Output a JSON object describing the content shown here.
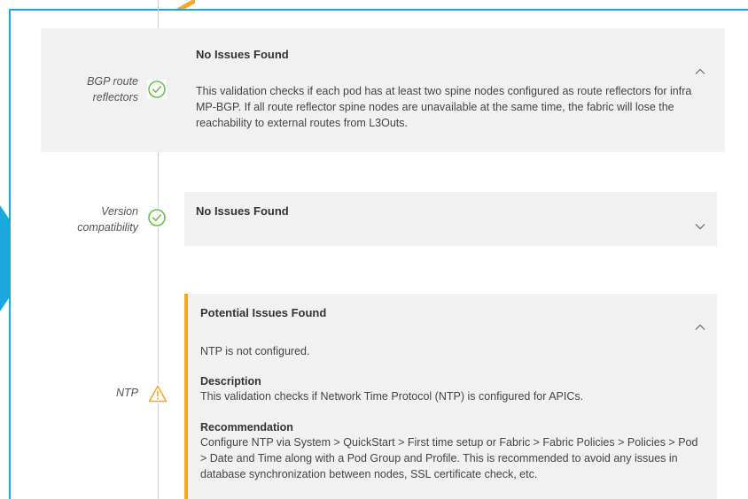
{
  "items": [
    {
      "label_line1": "BGP route",
      "label_line2": "reflectors",
      "status_icon": "check-circle-icon",
      "title": "No Issues Found",
      "text": "This validation checks if each pod has at least two spine nodes configured as route reflectors for infra MP-BGP. If all route reflector spine nodes are unavailable at the same time, the fabric will lose the reachability to external routes from L3Outs.",
      "chevron": "^"
    },
    {
      "label_line1": "Version",
      "label_line2": "compatibility",
      "status_icon": "check-circle-icon",
      "title": "No Issues Found",
      "chevron": "v"
    },
    {
      "label": "NTP",
      "status_icon": "warning-triangle-icon",
      "title": "Potential Issues Found",
      "issue": "NTP is not configured.",
      "description_heading": "Description",
      "description": "This validation checks if Network Time Protocol (NTP) is configured for APICs.",
      "recommendation_heading": "Recommendation",
      "recommendation": "Configure NTP via System > QuickStart > First time setup or Fabric > Fabric Policies > Policies > Pod > Date and Time along with a Pod Group and Profile. This is recommended to avoid any issues in database synchronization between nodes, SSL certificate check, etc.",
      "chevron": "^"
    }
  ],
  "colors": {
    "accent_frame": "#1aa7dc",
    "ok_green": "#6cc04a",
    "warning_orange": "#f5a623",
    "card_bg": "#f1f1f1"
  }
}
